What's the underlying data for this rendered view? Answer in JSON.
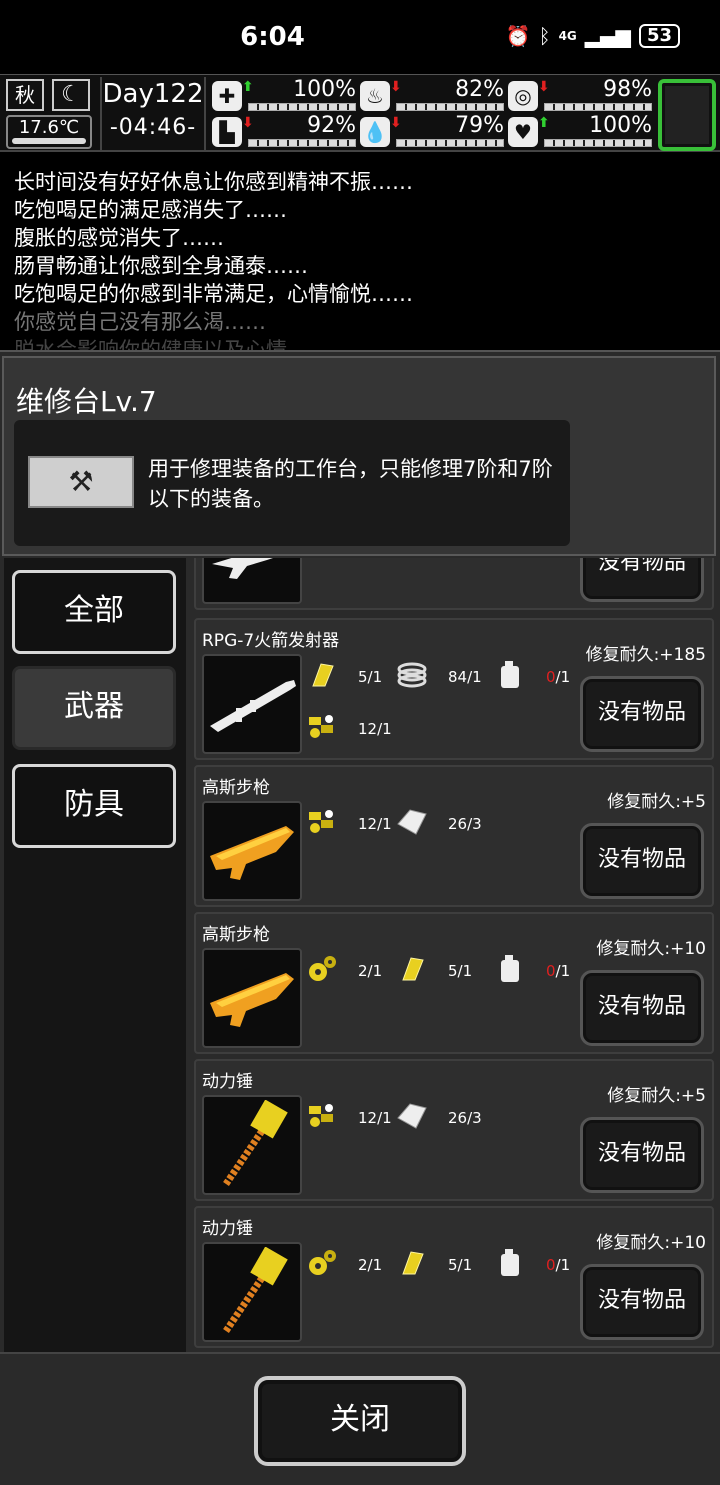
{
  "status_bar": {
    "time": "6:04",
    "network": "4G",
    "battery": "53"
  },
  "hud": {
    "season": "秋",
    "temperature": "17.6℃",
    "day": "Day122",
    "clock": "-04:46-",
    "stats": [
      {
        "icon": "medkit-icon",
        "trend": "up",
        "value": "100%"
      },
      {
        "icon": "stomach-icon",
        "trend": "down",
        "value": "82%"
      },
      {
        "icon": "toilet-icon",
        "trend": "down",
        "value": "98%"
      },
      {
        "icon": "boot-icon",
        "trend": "down",
        "value": "92%"
      },
      {
        "icon": "water-drop-icon",
        "trend": "down",
        "value": "79%"
      },
      {
        "icon": "heart-icon",
        "trend": "up",
        "value": "100%"
      }
    ]
  },
  "log": [
    "长时间没有好好休息让你感到精神不振……",
    "吃饱喝足的满足感消失了……",
    "腹胀的感觉消失了……",
    "肠胃畅通让你感到全身通泰……",
    "吃饱喝足的你感到非常满足，心情愉悦……",
    "你感觉自己没有那么渴……",
    "脱水会影响你的健康以及心情"
  ],
  "dialog": {
    "title": "维修台Lv.7",
    "description": "用于修理装备的工作台，只能修理7阶和7阶以下的装备。",
    "tabs": [
      "全部",
      "武器",
      "防具"
    ],
    "close_label": "关闭",
    "items": [
      {
        "name": "",
        "repair": "",
        "button": "没有物品",
        "weapon": "rifle-icon",
        "materials": []
      },
      {
        "name": "RPG-7火箭发射器",
        "repair": "修复耐久:+185",
        "button": "没有物品",
        "weapon": "rocket-launcher-icon",
        "materials": [
          {
            "icon": "gold-plate-icon",
            "value": "5/1"
          },
          {
            "icon": "rope-coil-icon",
            "value": "84/1"
          },
          {
            "icon": "fuel-can-icon",
            "value_red": "0",
            "value_rest": "/1"
          },
          {
            "icon": "parts-icon",
            "value": "12/1"
          }
        ]
      },
      {
        "name": "高斯步枪",
        "repair": "修复耐久:+5",
        "button": "没有物品",
        "weapon": "gauss-rifle-icon",
        "materials": [
          {
            "icon": "parts-icon",
            "value": "12/1"
          },
          {
            "icon": "cloth-icon",
            "value": "26/3"
          }
        ]
      },
      {
        "name": "高斯步枪",
        "repair": "修复耐久:+10",
        "button": "没有物品",
        "weapon": "gauss-rifle-icon",
        "materials": [
          {
            "icon": "gears-icon",
            "value": "2/1"
          },
          {
            "icon": "gold-plate-icon",
            "value": "5/1"
          },
          {
            "icon": "fuel-can-icon",
            "value_red": "0",
            "value_rest": "/1"
          }
        ]
      },
      {
        "name": "动力锤",
        "repair": "修复耐久:+5",
        "button": "没有物品",
        "weapon": "power-hammer-icon",
        "materials": [
          {
            "icon": "parts-icon",
            "value": "12/1"
          },
          {
            "icon": "cloth-icon",
            "value": "26/3"
          }
        ]
      },
      {
        "name": "动力锤",
        "repair": "修复耐久:+10",
        "button": "没有物品",
        "weapon": "power-hammer-icon",
        "materials": [
          {
            "icon": "gears-icon",
            "value": "2/1"
          },
          {
            "icon": "gold-plate-icon",
            "value": "5/1"
          },
          {
            "icon": "fuel-can-icon",
            "value_red": "0",
            "value_rest": "/1"
          }
        ]
      }
    ]
  }
}
